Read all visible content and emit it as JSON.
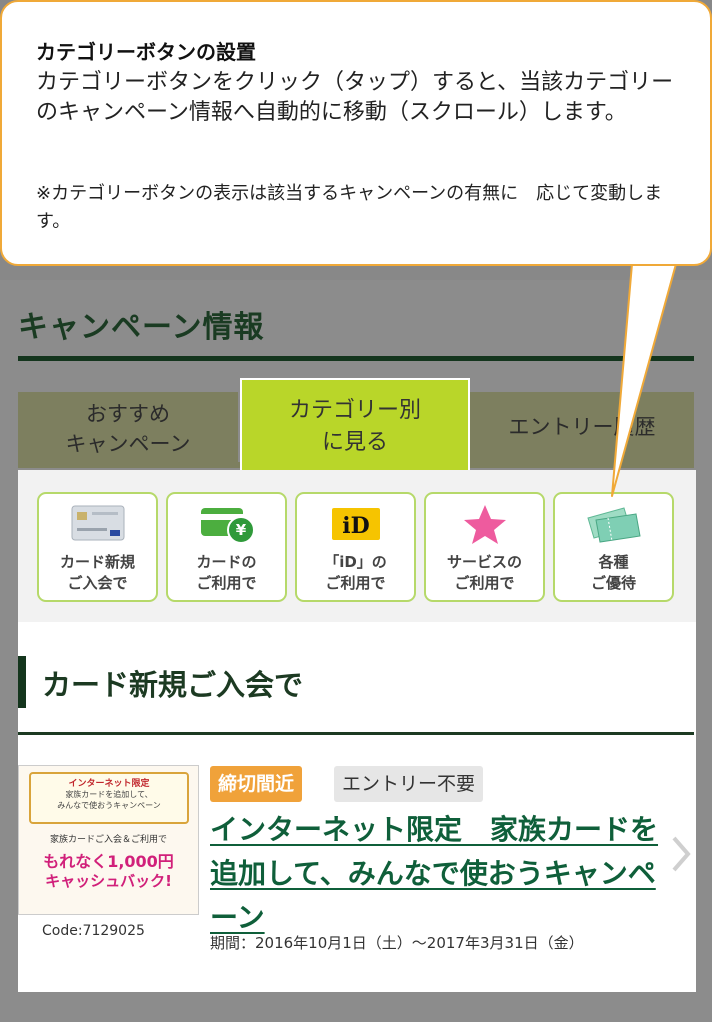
{
  "callout": {
    "heading": "カテゴリーボタンの設置",
    "body": "カテゴリーボタンをクリック（タップ）すると、当該カテゴリーのキャンペーン情報へ自動的に移動（スクロール）します。",
    "note": "※カテゴリーボタンの表示は該当するキャンペーンの有無に　応じて変動します。"
  },
  "page": {
    "title": "キャンペーン情報",
    "tabs": [
      {
        "line1": "おすすめ",
        "line2": "キャンペーン"
      },
      {
        "line1": "カテゴリー別",
        "line2": "に見る"
      },
      {
        "line1": "エントリー履歴",
        "line2": ""
      }
    ]
  },
  "categories": [
    {
      "line1": "カード新規",
      "line2": "ご入会で",
      "icon": "credit-card-icon"
    },
    {
      "line1": "カードの",
      "line2": "ご利用で",
      "icon": "card-yen-icon"
    },
    {
      "line1": "「iD」の",
      "line2": "ご利用で",
      "icon": "id-logo-icon",
      "icon_text": "iD"
    },
    {
      "line1": "サービスの",
      "line2": "ご利用で",
      "icon": "star-icon"
    },
    {
      "line1": "各種",
      "line2": "ご優待",
      "icon": "tickets-icon"
    }
  ],
  "section": {
    "title": "カード新規ご入会で"
  },
  "campaign": {
    "thumb_heading": "インターネット限定",
    "thumb_sub1": "家族カードを追加して、",
    "thumb_sub2": "みんなで使おうキャンペーン",
    "thumb_line1": "家族カードご入会＆ご利用で",
    "thumb_line2": "もれなく1,000円",
    "thumb_line3": "キャッシュバック!",
    "code": "Code:7129025",
    "badge_deadline": "締切間近",
    "badge_entry": "エントリー不要",
    "title": "インターネット限定　家族カードを追加して、みんなで使おうキャンペーン",
    "period": "期間：2016年10月1日（土）～2017年3月31日（金）"
  },
  "colors": {
    "callout_border": "#f0a938",
    "active_tab": "#b9d629",
    "brand_green": "#14351d",
    "category_border": "#b6d96a",
    "deadline_badge": "#f0a23a",
    "link_green": "#0f5f3a"
  }
}
